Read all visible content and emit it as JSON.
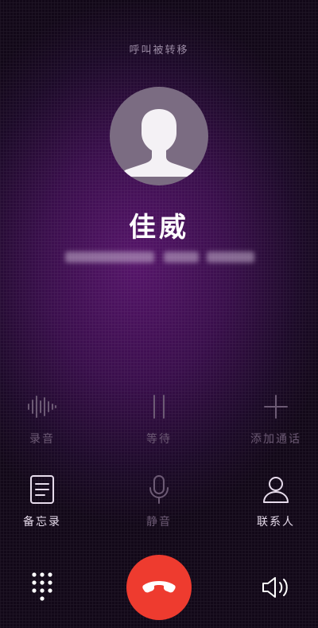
{
  "status_text": "呼叫被转移",
  "caller": {
    "name": "佳威"
  },
  "controls_row1": [
    {
      "label": "录音",
      "icon": "waveform-icon",
      "enabled": false
    },
    {
      "label": "等待",
      "icon": "pause-icon",
      "enabled": false
    },
    {
      "label": "添加通话",
      "icon": "plus-icon",
      "enabled": false
    }
  ],
  "controls_row2": [
    {
      "label": "备忘录",
      "icon": "note-icon",
      "enabled": true
    },
    {
      "label": "静音",
      "icon": "microphone-icon",
      "enabled": false
    },
    {
      "label": "联系人",
      "icon": "person-icon",
      "enabled": true
    }
  ],
  "bottom_bar": {
    "keypad_icon": "keypad-icon",
    "hangup_icon": "hangup-phone-icon",
    "speaker_icon": "speaker-icon"
  },
  "colors": {
    "background_center": "#56156a",
    "background_edge": "#120818",
    "hangup": "#ee3b2f",
    "label_enabled": "#e7dcec",
    "label_disabled": "#6c5a74"
  }
}
